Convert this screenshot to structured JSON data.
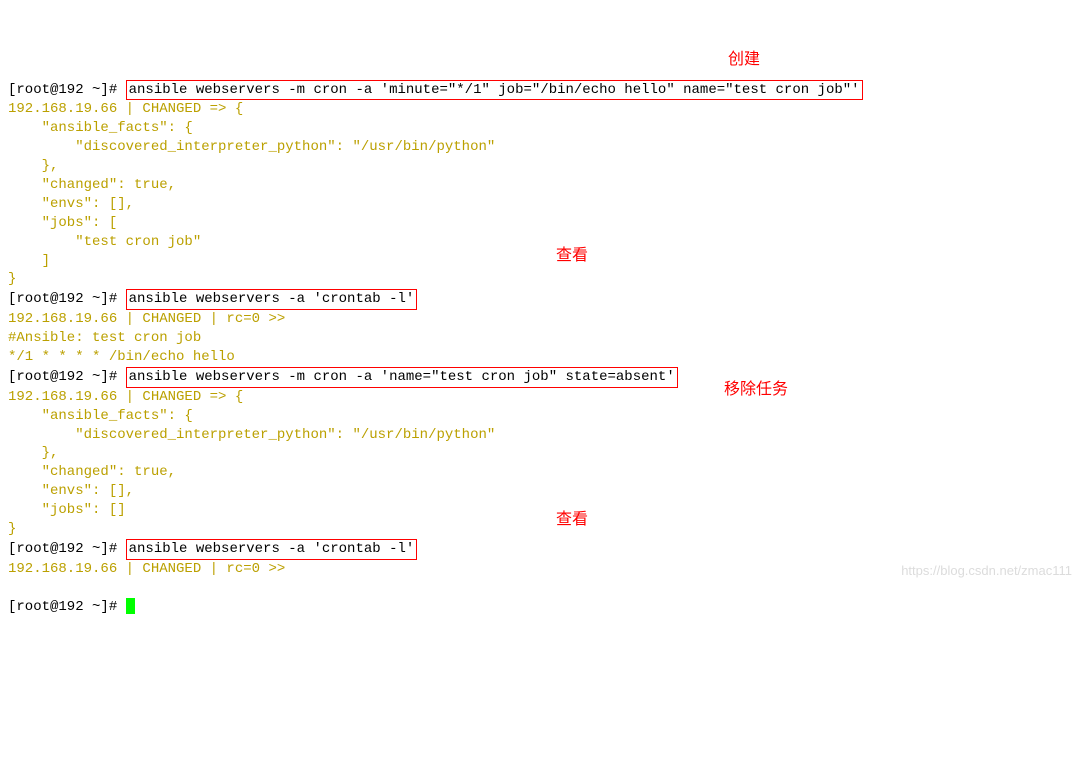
{
  "prompt": "[root@192 ~]# ",
  "cmd1": "ansible webservers -m cron -a 'minute=\"*/1\" job=\"/bin/echo hello\" name=\"test cron job\"'",
  "out1_l1": "192.168.19.66 | CHANGED => {",
  "out1_l2": "    \"ansible_facts\": {",
  "out1_l3": "        \"discovered_interpreter_python\": \"/usr/bin/python\"",
  "out1_l4": "    },",
  "out1_l5": "    \"changed\": true,",
  "out1_l6": "    \"envs\": [],",
  "out1_l7": "    \"jobs\": [",
  "out1_l8": "        \"test cron job\"",
  "out1_l9": "    ]",
  "out1_l10": "}",
  "cmd2": "ansible webservers -a 'crontab -l'",
  "out2_l1": "192.168.19.66 | CHANGED | rc=0 >>",
  "out2_l2": "#Ansible: test cron job",
  "out2_l3": "*/1 * * * * /bin/echo hello",
  "cmd3": "ansible webservers -m cron -a 'name=\"test cron job\" state=absent'",
  "out3_l1": "192.168.19.66 | CHANGED => {",
  "out3_l2": "    \"ansible_facts\": {",
  "out3_l3": "        \"discovered_interpreter_python\": \"/usr/bin/python\"",
  "out3_l4": "    },",
  "out3_l5": "    \"changed\": true,",
  "out3_l6": "    \"envs\": [],",
  "out3_l7": "    \"jobs\": []",
  "out3_l8": "}",
  "cmd4": "ansible webservers -a 'crontab -l'",
  "out4_l1": "192.168.19.66 | CHANGED | rc=0 >>",
  "blank": "",
  "ann1": "创建",
  "ann2": "查看",
  "ann3": "移除任务",
  "ann4": "查看",
  "watermark": "https://blog.csdn.net/zmac111"
}
